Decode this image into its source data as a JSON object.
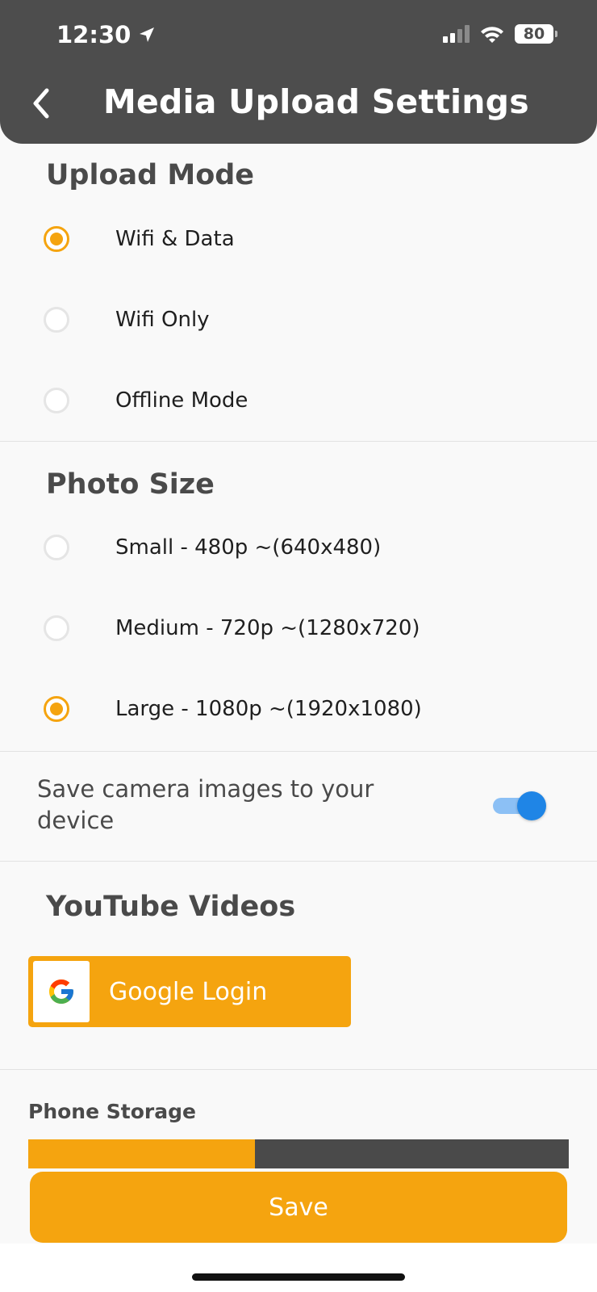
{
  "status_bar": {
    "time": "12:30",
    "battery": "80"
  },
  "header": {
    "title": "Media Upload Settings"
  },
  "upload_mode": {
    "title": "Upload Mode",
    "options": [
      {
        "label": "Wifi & Data",
        "selected": true
      },
      {
        "label": "Wifi Only",
        "selected": false
      },
      {
        "label": "Offline Mode",
        "selected": false
      }
    ]
  },
  "photo_size": {
    "title": "Photo Size",
    "options": [
      {
        "label": "Small - 480p ~(640x480)",
        "selected": false
      },
      {
        "label": "Medium - 720p ~(1280x720)",
        "selected": false
      },
      {
        "label": "Large - 1080p ~(1920x1080)",
        "selected": true
      }
    ]
  },
  "save_camera": {
    "label": "Save camera images to your device",
    "enabled": true
  },
  "youtube": {
    "title": "YouTube Videos",
    "login_label": "Google Login"
  },
  "storage": {
    "label": "Phone Storage",
    "used_fraction": 0.42
  },
  "save_button": {
    "label": "Save"
  },
  "colors": {
    "accent": "#f5a40f",
    "header": "#4d4d4d",
    "toggle": "#1f85e6"
  }
}
